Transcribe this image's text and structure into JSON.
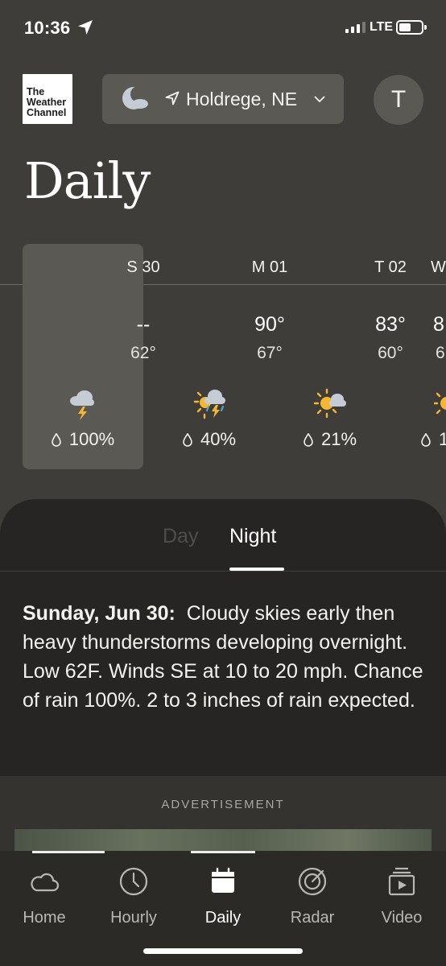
{
  "status_bar": {
    "time": "10:36",
    "network": "LTE",
    "icons": [
      "location-arrow-icon",
      "signal-icon",
      "battery-icon"
    ]
  },
  "header": {
    "logo_lines": [
      "The",
      "Weather",
      "Channel"
    ],
    "location": "Holdrege, NE",
    "avatar_initial": "T",
    "title": "Daily"
  },
  "days": [
    {
      "label": "S 30",
      "high": "--",
      "low": "62°",
      "precip": "100%",
      "icon": "thunderstorm-icon",
      "selected": true
    },
    {
      "label": "M 01",
      "high": "90°",
      "low": "67°",
      "precip": "40%",
      "icon": "sun-thunderstorm-icon",
      "selected": false
    },
    {
      "label": "T 02",
      "high": "83°",
      "low": "60°",
      "precip": "21%",
      "icon": "partly-cloudy-icon",
      "selected": false
    },
    {
      "label": "W",
      "high": "8",
      "low": "6",
      "precip": "1",
      "icon": "sun-icon",
      "selected": false
    }
  ],
  "tabs": {
    "day": "Day",
    "night": "Night",
    "active": "night"
  },
  "narrative": {
    "date": "Sunday, Jun 30:",
    "text": "Cloudy skies early then heavy thunderstorms developing overnight. Low 62F. Winds SE at 10 to 20 mph. Chance of rain 100%. 2 to 3 inches of rain expected."
  },
  "ad": {
    "label": "ADVERTISEMENT"
  },
  "bottom_nav": {
    "items": [
      {
        "label": "Home",
        "icon": "home-cloud-icon"
      },
      {
        "label": "Hourly",
        "icon": "clock-icon"
      },
      {
        "label": "Daily",
        "icon": "calendar-icon"
      },
      {
        "label": "Radar",
        "icon": "radar-icon"
      },
      {
        "label": "Video",
        "icon": "video-icon"
      }
    ],
    "active": "Daily"
  },
  "colors": {
    "background": "#3f3d39",
    "panel": "#262523",
    "selected_day": "#5b5954",
    "sun_yellow": "#f5b731",
    "bolt_yellow": "#f5b731",
    "cloud_gray": "#c6ccd6",
    "rain_blue": "#4fa3e0"
  }
}
